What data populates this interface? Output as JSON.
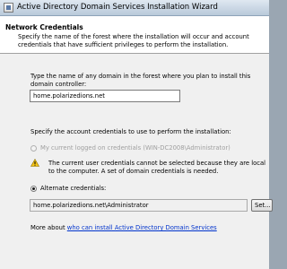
{
  "window": {
    "title": "Active Directory Domain Services Installation Wizard"
  },
  "header": {
    "title": "Network Credentials",
    "description": "Specify the name of the forest where the installation will occur and account credentials that have sufficient privileges to perform the installation."
  },
  "domain": {
    "prompt": "Type the name of any domain in the forest where you plan to install this domain controller:",
    "value": "home.polarizedions.net"
  },
  "credentials": {
    "prompt": "Specify the account credentials to use to perform the installation:",
    "current_user_label": "My current logged on credentials (WIN-DC2008\\Administrator)",
    "warning": "The current user credentials cannot be selected because they are local to the computer. A set of domain credentials is needed.",
    "alternate_label": "Alternate credentials:",
    "alternate_value": "home.polarizedions.net\\Administrator",
    "set_button": "Set..."
  },
  "more_about": {
    "prefix": "More about ",
    "link": "who can install Active Directory Domain Services"
  }
}
